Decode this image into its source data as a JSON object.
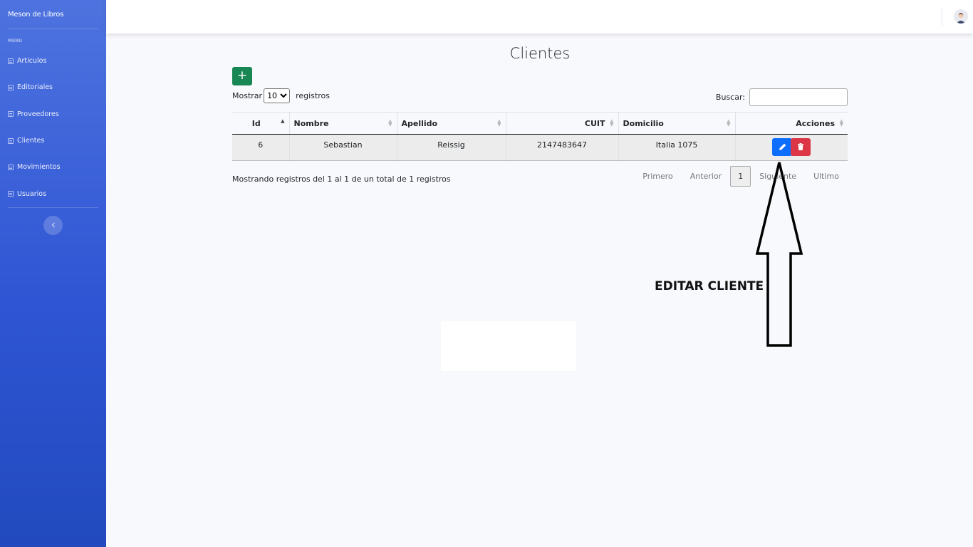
{
  "sidebar": {
    "brand": "Meson de Libros",
    "heading": "MENU",
    "items": [
      {
        "label": "Articulos",
        "icon": "table-icon"
      },
      {
        "label": "Editoriales",
        "icon": "table-icon"
      },
      {
        "label": "Proveedores",
        "icon": "table-icon"
      },
      {
        "label": "Clientes",
        "icon": "table-icon"
      },
      {
        "label": "Movimientos",
        "icon": "table-icon"
      },
      {
        "label": "Usuarios",
        "icon": "table-icon"
      }
    ],
    "toggle_icon": "chevron-left-icon"
  },
  "topbar": {
    "avatar_icon": "user-avatar-icon"
  },
  "main": {
    "title": "Clientes",
    "add_label": "+",
    "length": {
      "prefix": "Mostrar",
      "selected": "10",
      "suffix": "registros"
    },
    "search": {
      "label": "Buscar:",
      "value": ""
    },
    "table": {
      "columns": [
        "Id",
        "Nombre",
        "Apellido",
        "CUIT",
        "Domicilio",
        "Acciones"
      ],
      "rows": [
        {
          "id": "6",
          "nombre": "Sebastian",
          "apellido": "Reissig",
          "cuit": "2147483647",
          "domicilio": "Italia 1075"
        }
      ]
    },
    "info": "Mostrando registros del 1 al 1 de un total de 1 registros",
    "pagination": {
      "first": "Primero",
      "prev": "Anterior",
      "current": "1",
      "next": "Siguiente",
      "last": "Ultimo"
    }
  },
  "annotation": {
    "text": "EDITAR CLIENTE"
  },
  "colors": {
    "sidebar": "#4e73df",
    "add": "#198754",
    "edit": "#0d6efd",
    "delete": "#dc3545"
  }
}
